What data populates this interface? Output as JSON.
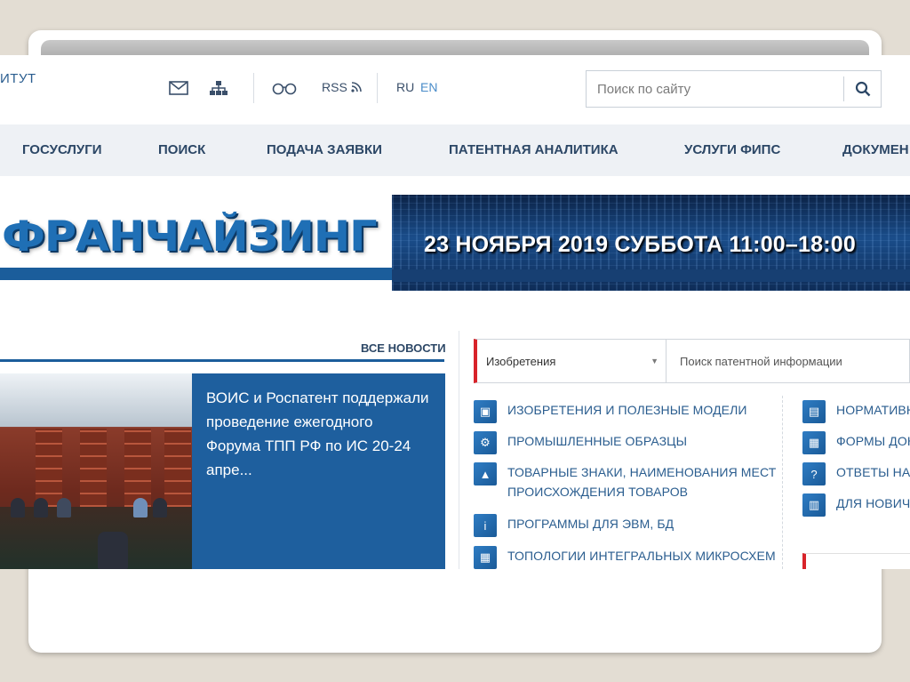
{
  "header": {
    "brand_fragment": "ИТУТ",
    "rss_label": "RSS",
    "lang_ru": "RU",
    "lang_en": "EN",
    "search_placeholder": "Поиск по сайту",
    "icons": [
      "mail-icon",
      "sitemap-icon",
      "glasses-icon",
      "rss-icon",
      "search-icon"
    ]
  },
  "nav": {
    "items": [
      "ГОСУСЛУГИ",
      "ПОИСК",
      "ПОДАЧА ЗАЯВКИ",
      "ПАТЕНТНАЯ АНАЛИТИКА",
      "УСЛУГИ ФИПС",
      "ДОКУМЕН"
    ]
  },
  "banner": {
    "title": "ФРАНЧАЙЗИНГ",
    "date_text": "23 НОЯБРЯ 2019  СУББОТА  11:00–18:00"
  },
  "news": {
    "all_news_label": "ВСЕ НОВОСТИ",
    "headline": "ВОИС и Роспатент поддержали проведение ежегодного Форума ТПП РФ по ИС 20-24 апре..."
  },
  "patent_search": {
    "select_value": "Изобретения",
    "search_placeholder": "Поиск патентной информации"
  },
  "categories_left": [
    {
      "label": "ИЗОБРЕТЕНИЯ И ПОЛЕЗНЫЕ МОДЕЛИ",
      "icon": "invention-icon"
    },
    {
      "label": "ПРОМЫШЛЕННЫЕ ОБРАЗЦЫ",
      "icon": "gears-icon"
    },
    {
      "label": "ТОВАРНЫЕ ЗНАКИ, НАИМЕНОВАНИЯ МЕСТ",
      "label2": "ПРОИСХОЖДЕНИЯ ТОВАРОВ",
      "icon": "tower-icon"
    },
    {
      "label": "ПРОГРАММЫ ДЛЯ ЭВМ, БД",
      "icon": "info-icon"
    },
    {
      "label": "ТОПОЛОГИИ ИНТЕГРАЛЬНЫХ МИКРОСХЕМ",
      "icon": "chip-icon"
    }
  ],
  "categories_right": [
    {
      "label": "НОРМАТИВН",
      "icon": "book-icon",
      "glyph": "▤"
    },
    {
      "label": "ФОРМЫ ДОК",
      "icon": "form-icon",
      "glyph": "▦"
    },
    {
      "label": "ОТВЕТЫ НА",
      "icon": "question-icon",
      "glyph": "?"
    },
    {
      "label": "ДЛЯ НОВИЧ",
      "icon": "open-book-icon",
      "glyph": "▥"
    }
  ],
  "colors": {
    "accent_blue": "#1e5f9e",
    "nav_text": "#2c4766",
    "link_blue": "#2a5d8f",
    "red_accent": "#d8232a"
  }
}
